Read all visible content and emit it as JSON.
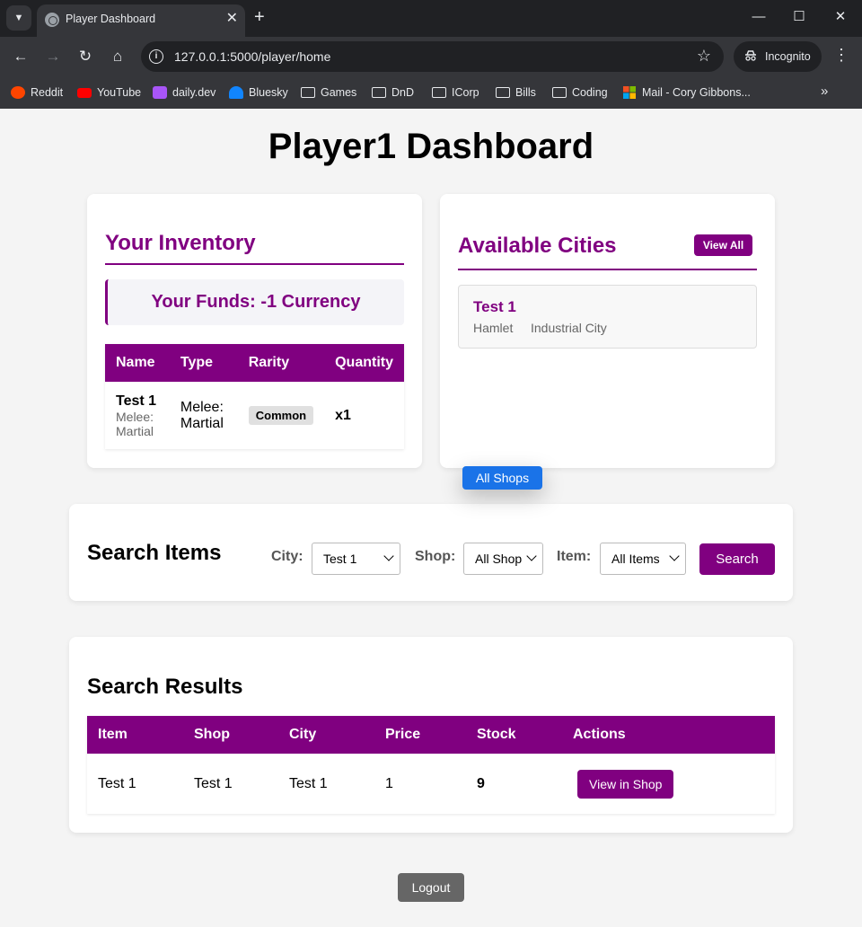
{
  "browser": {
    "tab_title": "Player Dashboard",
    "url": "127.0.0.1:5000/player/home",
    "profile_label": "Incognito",
    "bookmarks": [
      "Reddit",
      "YouTube",
      "daily.dev",
      "Bluesky",
      "Games",
      "DnD",
      "ICorp",
      "Bills",
      "Coding",
      "Mail - Cory Gibbons..."
    ]
  },
  "page": {
    "title": "Player1 Dashboard"
  },
  "inventory": {
    "heading": "Your Inventory",
    "funds": "Your Funds: -1 Currency",
    "columns": [
      "Name",
      "Type",
      "Rarity",
      "Quantity"
    ],
    "rows": [
      {
        "name": "Test 1",
        "subtitle": "Melee: Martial",
        "type": "Melee: Martial",
        "rarity": "Common",
        "quantity": "x1"
      }
    ]
  },
  "cities": {
    "heading": "Available Cities",
    "view_all": "View All",
    "items": [
      {
        "name": "Test 1",
        "size": "Hamlet",
        "type": "Industrial City"
      }
    ]
  },
  "search": {
    "heading": "Search Items",
    "city_label": "City:",
    "city_value": "Test 1",
    "shop_label": "Shop:",
    "shop_value": "All Shop",
    "shop_option": "All Shops",
    "item_label": "Item:",
    "item_value": "All Items",
    "button": "Search"
  },
  "results": {
    "heading": "Search Results",
    "columns": [
      "Item",
      "Shop",
      "City",
      "Price",
      "Stock",
      "Actions"
    ],
    "rows": [
      {
        "item": "Test 1",
        "shop": "Test 1",
        "city": "Test 1",
        "price": "1",
        "stock": "9",
        "action": "View in Shop"
      }
    ]
  },
  "logout": "Logout",
  "colors": {
    "accent": "#800080",
    "stock": "#008000",
    "dropdown_highlight": "#1a73e8"
  }
}
